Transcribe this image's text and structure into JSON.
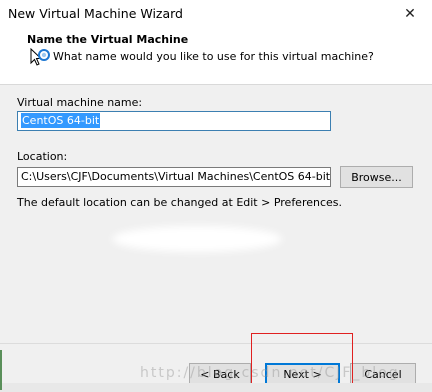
{
  "window": {
    "title": "New Virtual Machine Wizard",
    "close_glyph": "✕"
  },
  "header": {
    "title": "Name the Virtual Machine",
    "subtitle": "What name would you like to use for this virtual machine?"
  },
  "form": {
    "name_label": "Virtual machine name:",
    "name_value": "CentOS 64-bit",
    "location_label": "Location:",
    "location_value": "C:\\Users\\CJF\\Documents\\Virtual Machines\\CentOS 64-bit",
    "browse_label": "Browse...",
    "hint": "The default location can be changed at Edit > Preferences."
  },
  "footer": {
    "back_label": "< Back",
    "next_label": "Next >",
    "cancel_label": "Cancel"
  },
  "watermark": "http://blog.csdn.net/CJF_blog",
  "colors": {
    "selection": "#3399ff",
    "annotation_box": "#e02020"
  }
}
